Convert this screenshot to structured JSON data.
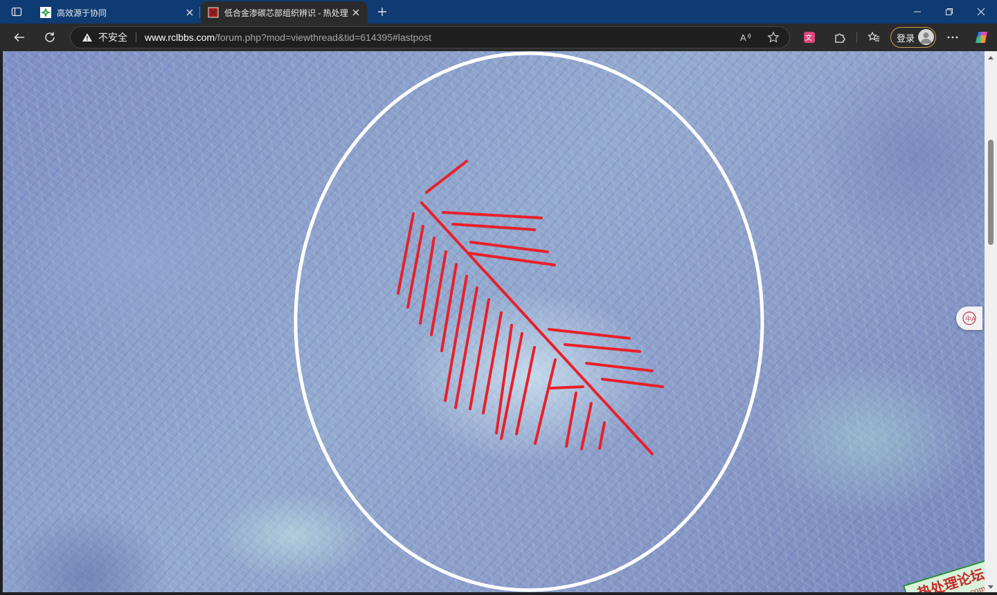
{
  "browser": {
    "tabs": [
      {
        "title": "高效源于协同",
        "active": false,
        "favicon": "green-cross-favicon"
      },
      {
        "title": "低合金渗碳芯部组织辨识 - 热处理",
        "active": true,
        "favicon": "red-square-favicon"
      }
    ],
    "address_bar": {
      "security_label": "不安全",
      "url_host": "www.rclbbs.com",
      "url_path": "/forum.php?mod=viewthread&tid=614395#lastpost"
    },
    "login_label": "登录",
    "icons": [
      "tab-actions-icon",
      "close-icon",
      "new-tab-icon",
      "minimize-icon",
      "restore-icon",
      "window-close-icon",
      "back-icon",
      "refresh-icon",
      "warning-icon",
      "read-aloud-icon",
      "favorite-star-icon",
      "translate-extension-icon",
      "extensions-icon",
      "favorites-icon",
      "avatar-icon",
      "more-icon",
      "copilot-icon"
    ]
  },
  "page": {
    "image_subject": "micrograph-with-annotation",
    "watermark_text": "热处理论坛",
    "watermark_url": "www.rclbbs.com",
    "annotation_color": "#e8202a",
    "circle_color": "#ffffff"
  },
  "colors": {
    "titlebar": "#0f3b73",
    "toolbar": "#2b2b2b",
    "login_border": "#c9a04a"
  }
}
